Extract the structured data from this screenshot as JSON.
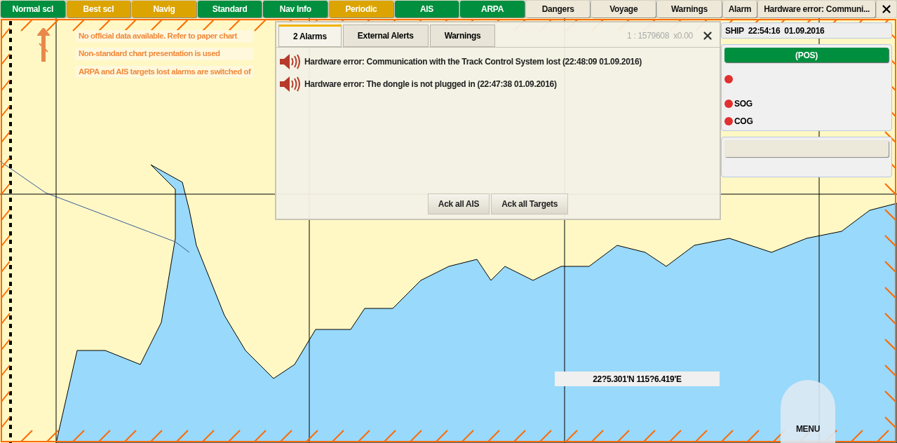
{
  "toolbar": {
    "buttons": [
      {
        "label": "Normal scl",
        "kind": "green"
      },
      {
        "label": "Best scl",
        "kind": "gold"
      },
      {
        "label": "Navig",
        "kind": "gold"
      },
      {
        "label": "Standard",
        "kind": "green"
      },
      {
        "label": "Nav Info",
        "kind": "green"
      },
      {
        "label": "Periodic",
        "kind": "gold"
      },
      {
        "label": "AIS",
        "kind": "green"
      },
      {
        "label": "ARPA",
        "kind": "green"
      },
      {
        "label": "Dangers",
        "kind": "plain"
      },
      {
        "label": "Voyage",
        "kind": "plain"
      },
      {
        "label": "Warnings",
        "kind": "plain"
      },
      {
        "label": "Alarm",
        "kind": "plain"
      },
      {
        "label": "Hardware error: Communi...",
        "kind": "plain"
      }
    ]
  },
  "map": {
    "notices": [
      "No official data available. Refer to paper chart",
      "Non-standard chart presentation is used",
      "ARPA and AIS targets lost alarms are switched of"
    ],
    "scale": "1 : 1579608  x0.00",
    "cursor_position": "22?5.301'N 115?6.419'E",
    "menu": "MENU"
  },
  "alarm_panel": {
    "tabs": [
      {
        "label": "2 Alarms",
        "selected": true
      },
      {
        "label": "External Alerts",
        "selected": false
      },
      {
        "label": "Warnings",
        "selected": false
      }
    ],
    "alarms": [
      {
        "text": "Hardware error: Communication with the Track Control System lost (22:48:09  01.09.2016)"
      },
      {
        "text": "Hardware error: The dongle is not plugged in (22:47:38  01.09.2016)"
      }
    ],
    "buttons": [
      "Ack all AIS",
      "Ack all Targets"
    ]
  },
  "ship": {
    "header": "SHIP  22:54:16  01.09.2016",
    "position_label": "(POS)",
    "sensors": [
      {
        "alarm": true
      },
      {
        "label": "SOG",
        "alarm": true
      },
      {
        "label": "COG",
        "alarm": true
      }
    ]
  }
}
